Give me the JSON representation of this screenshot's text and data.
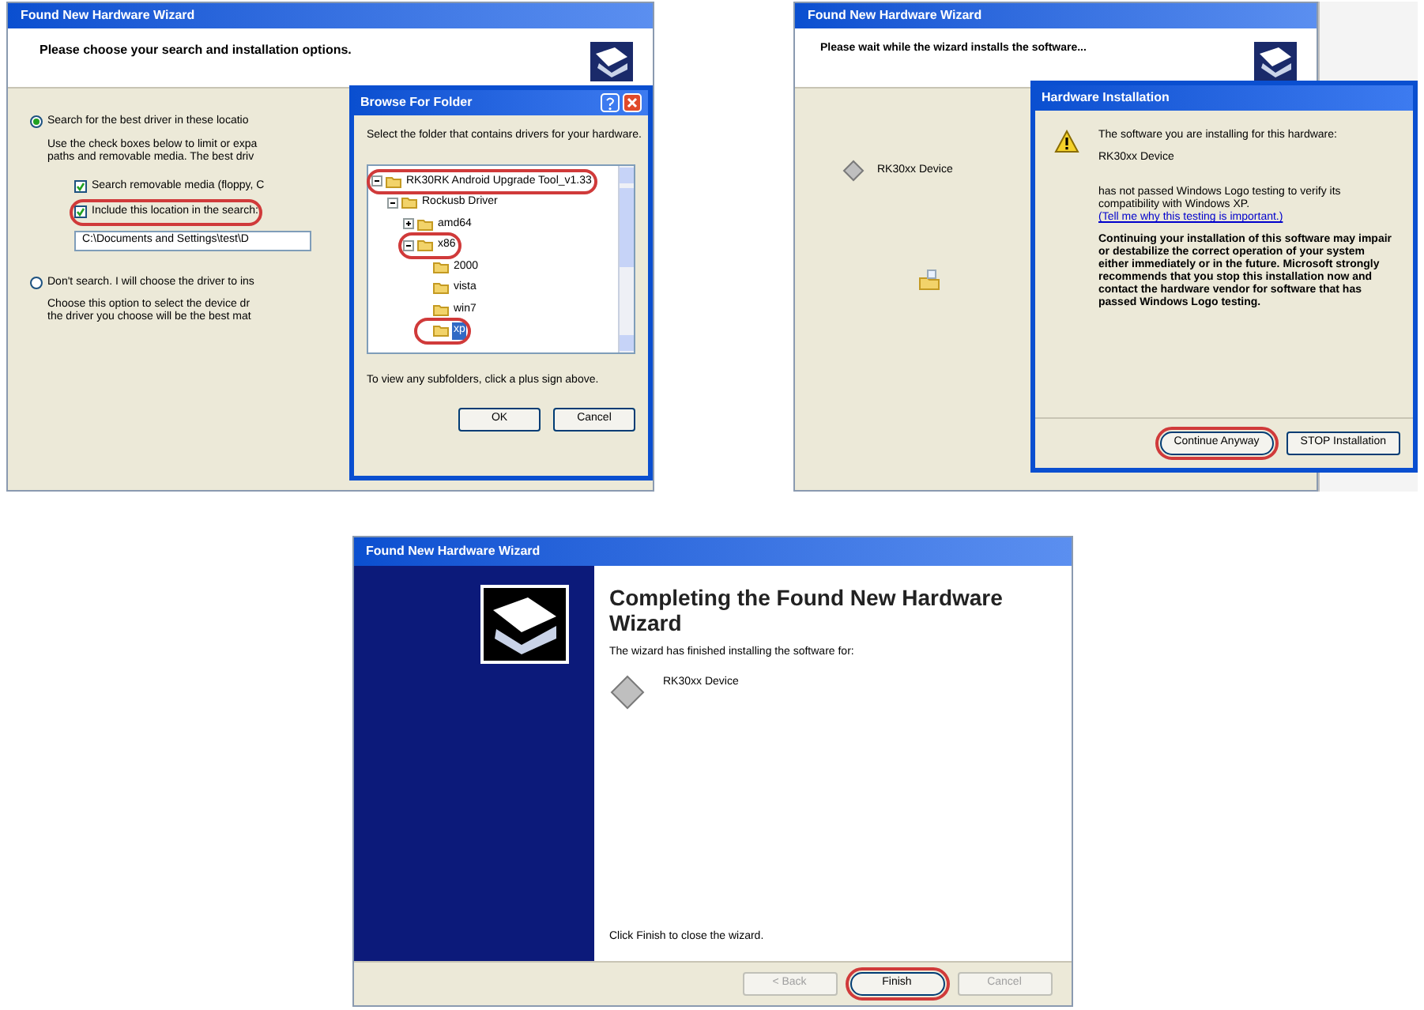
{
  "search_options_window": {
    "title": "Found New Hardware Wizard",
    "header": "Please choose your search and installation options.",
    "options": [
      {
        "label": "Search for the best driver in these locatio",
        "selected": true,
        "description": [
          "Use the check boxes below to limit or expa",
          "paths and removable media. The best driv"
        ],
        "checks": [
          {
            "label": "Search removable media (floppy, C",
            "checked": true,
            "circled": false
          },
          {
            "label": "Include this location in the search:",
            "checked": true,
            "circled": true
          }
        ],
        "path": "C:\\Documents and Settings\\test\\D"
      },
      {
        "label": "Don't search. I will choose the driver to ins",
        "selected": false,
        "description": [
          "Choose this option to select the device dr",
          "the driver you choose will be the best mat"
        ]
      }
    ],
    "browse_dialog": {
      "title": "Browse For Folder",
      "prompt": "Select the folder that contains drivers for your hardware.",
      "tree": [
        {
          "label": "RK30RK Android Upgrade Tool_v1.33",
          "expanded": true,
          "selected": false,
          "circled": true,
          "children": [
            {
              "label": "Rockusb Driver",
              "expanded": true,
              "selected": false,
              "circled": false,
              "children": [
                {
                  "label": "amd64",
                  "expanded": false,
                  "selected": false,
                  "circled": false
                },
                {
                  "label": "x86",
                  "expanded": true,
                  "selected": false,
                  "circled": true,
                  "children": [
                    {
                      "label": "2000",
                      "selected": false,
                      "circled": false
                    },
                    {
                      "label": "vista",
                      "selected": false,
                      "circled": false
                    },
                    {
                      "label": "win7",
                      "selected": false,
                      "circled": false
                    },
                    {
                      "label": "xp",
                      "selected": true,
                      "circled": true
                    }
                  ]
                }
              ]
            }
          ]
        }
      ],
      "hint": "To view any subfolders, click a plus sign above.",
      "buttons": [
        {
          "label": "OK",
          "circled": false
        },
        {
          "label": "Cancel",
          "circled": false
        }
      ]
    }
  },
  "installing_window": {
    "title": "Found New Hardware Wizard",
    "header": "Please wait while the wizard installs the software...",
    "device": "RK30xx Device",
    "dialog": {
      "title": "Hardware Installation",
      "intro": "The software you are installing for this hardware:",
      "device": "RK30xx Device",
      "logo_text": "has not passed Windows Logo testing to verify its compatibility with Windows XP.",
      "logo_link": "(Tell me why this testing is important.)",
      "warning": "Continuing your installation of this software may impair or destabilize the correct operation of your system either immediately or in the future. Microsoft strongly recommends that you stop this installation now and contact the hardware vendor for software that has passed Windows Logo testing.",
      "buttons": [
        {
          "label": "Continue Anyway",
          "circled": true
        },
        {
          "label": "STOP Installation",
          "circled": false
        }
      ]
    }
  },
  "completed_window": {
    "title": "Found New Hardware Wizard",
    "heading": "Completing the Found New Hardware Wizard",
    "text": "The wizard has finished installing the software for:",
    "device": "RK30xx Device",
    "footer_text": "Click Finish to close the wizard.",
    "buttons": [
      {
        "label": "< Back",
        "disabled": true,
        "circled": false
      },
      {
        "label": "Finish",
        "disabled": false,
        "circled": true
      },
      {
        "label": "Cancel",
        "disabled": true,
        "circled": false
      }
    ]
  }
}
